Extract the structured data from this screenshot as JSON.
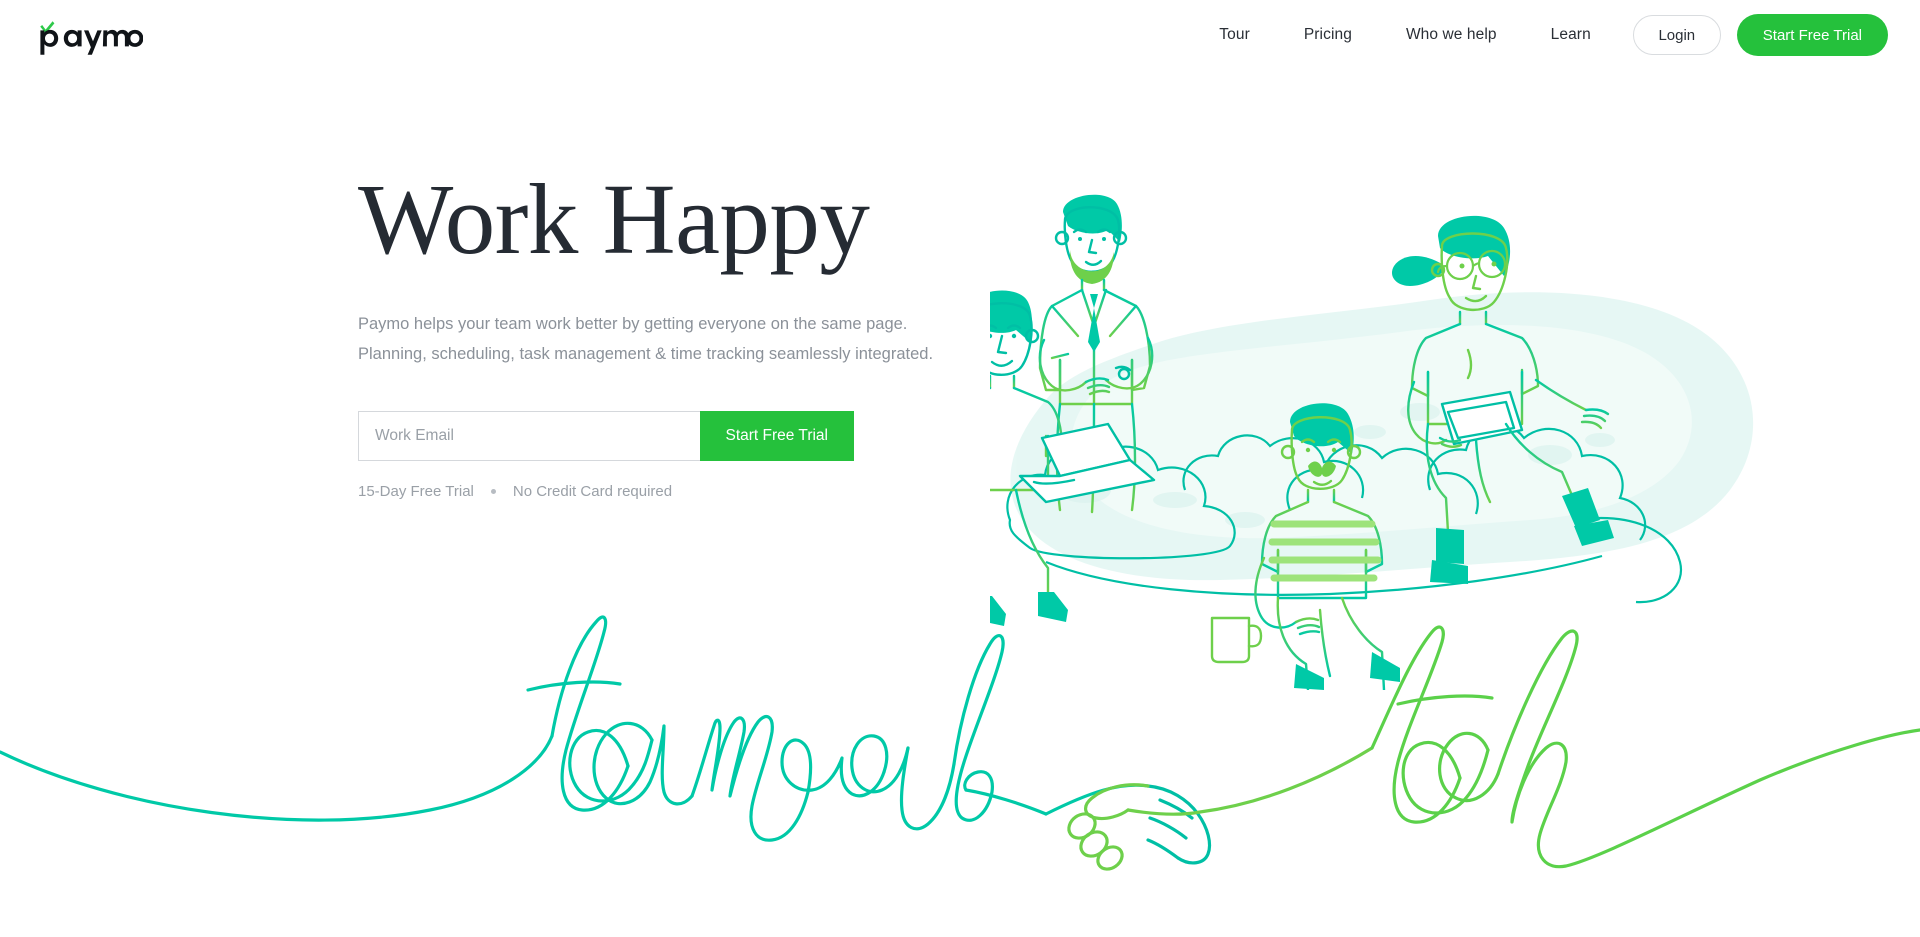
{
  "brand": {
    "logo_text": "paymo",
    "logo_accent_color": "#2ec94a",
    "logo_color": "#101418"
  },
  "colors": {
    "green": "#25c13c",
    "green_line": "#5bd14a",
    "teal": "#00c9a7",
    "teal_dark": "#00b89a",
    "headline": "#252b33",
    "body_text": "#8b9199",
    "muted_text": "#9aa0a7",
    "watercolor": "#d9f4ef"
  },
  "nav": {
    "items": [
      {
        "label": "Tour",
        "name": "nav-link-tour"
      },
      {
        "label": "Pricing",
        "name": "nav-link-pricing"
      },
      {
        "label": "Who we help",
        "name": "nav-link-who-we-help"
      },
      {
        "label": "Learn",
        "name": "nav-link-learn"
      }
    ],
    "login_label": "Login",
    "trial_label": "Start Free Trial"
  },
  "hero": {
    "title": "Work Happy",
    "subtitle_line1": "Paymo helps your team work better by getting everyone on the same page.",
    "subtitle_line2": "Planning, scheduling, task management & time tracking seamlessly integrated.",
    "email_placeholder": "Work Email",
    "email_value": "",
    "cta_label": "Start Free Trial",
    "fineprint_left": "15-Day Free Trial",
    "fineprint_right": "No Credit Card required"
  },
  "illustration": {
    "description": "line-art team of four people on clouds",
    "characters": [
      "standing-bearded-man-in-suit",
      "seated-man-with-laptop",
      "seated-mustached-man-striped-shirt-with-mug",
      "seated-woman-with-ponytail-glasses-and-tablet"
    ]
  },
  "script_art": {
    "word_left": "teamwork",
    "word_right": "tech",
    "connector": "handshake"
  }
}
